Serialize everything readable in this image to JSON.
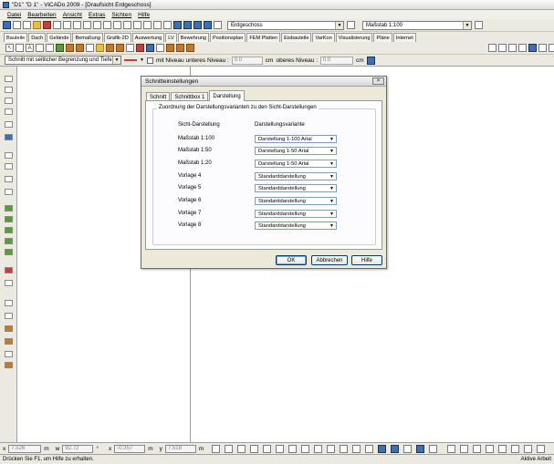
{
  "window": {
    "title": "\"D1\" \"D 1\" - ViCADo 2009 - [Draufsicht Erdgeschoss]"
  },
  "menu": [
    "Datei",
    "Bearbeiten",
    "Ansicht",
    "Extras",
    "Sichten",
    "Hilfe"
  ],
  "toolbar1": {
    "floor": "Erdgeschoss",
    "scale": "Maßstab 1:100"
  },
  "ribbon_tabs": [
    "Bauteile",
    "Dach",
    "Gelände",
    "Bemaßung",
    "Grafik-2D",
    "Auswertung",
    "LV",
    "Bewehrung",
    "Positionsplan",
    "FEM Platten",
    "Eisbauteile",
    "VarKon",
    "Visualisierung",
    "Pläne",
    "Internet"
  ],
  "toolbar3": {
    "section_mode": "Schnitt mit seitlicher Begrenzung und Tiefe",
    "with_level_label": "mit Niveau unteres Niveau :",
    "lower_value": "0.0",
    "lower_unit": "cm",
    "upper_label": "oberes Niveau :",
    "upper_value": "0.0",
    "upper_unit": "cm"
  },
  "dialog": {
    "title": "Schnitteinstellungen",
    "close": "×",
    "tabs": [
      "Schnitt",
      "Schnittbox 1",
      "Darstellung"
    ],
    "group_title": "Zuordnung der Darstellungsvarianten zu den Sicht-Darstellungen",
    "col_view": "Sicht-Darstellung",
    "col_variant": "Darstellungsvariante",
    "rows": [
      {
        "label": "Maßstab 1:100",
        "value": "Darstellung 1-100 Arial"
      },
      {
        "label": "Maßstab 1:50",
        "value": "Darstellung 1-50 Arial"
      },
      {
        "label": "Maßstab 1:20",
        "value": "Darstellung 1-50 Arial"
      },
      {
        "label": "Vorlage 4",
        "value": "Standarddarstellung"
      },
      {
        "label": "Vorlage 5",
        "value": "Standarddarstellung"
      },
      {
        "label": "Vorlage 6",
        "value": "Standarddarstellung"
      },
      {
        "label": "Vorlage 7",
        "value": "Standarddarstellung"
      },
      {
        "label": "Vorlage 8",
        "value": "Standarddarstellung"
      }
    ],
    "ok": "OK",
    "cancel": "Abbrechen",
    "help": "Hilfe"
  },
  "coords": {
    "x_label": "x",
    "x_value": "7.526",
    "x_unit": "m",
    "w_label": "w",
    "w_value": "92.72",
    "w_unit": "°",
    "dx_label": "x",
    "dx_value": "-0.357",
    "dx_unit": "m",
    "y_label": "y",
    "y_value": "7.518",
    "y_unit": "m"
  },
  "status": {
    "left": "Drücken Sie F1, um Hilfe zu erhalten.",
    "right": "Aktive Arbeit"
  }
}
